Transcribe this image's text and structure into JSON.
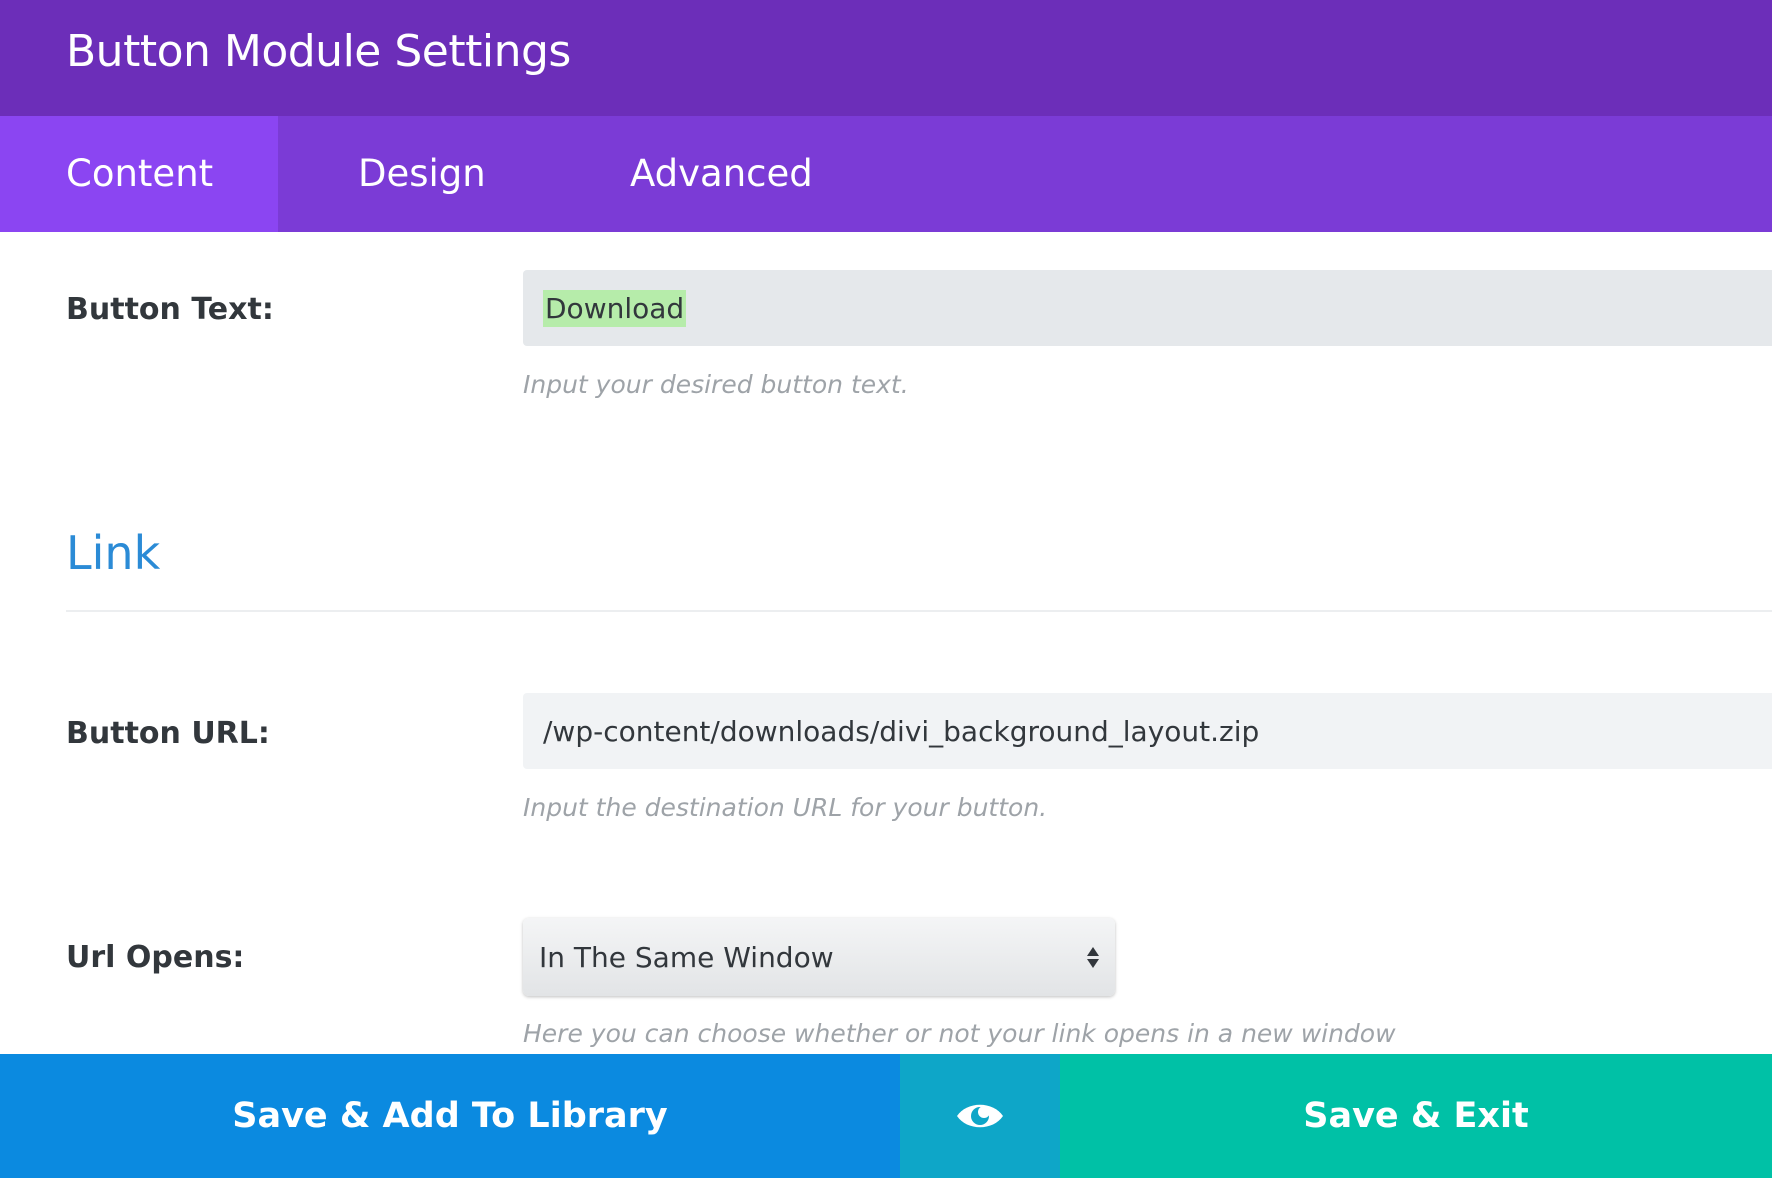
{
  "header": {
    "title": "Button Module Settings"
  },
  "tabs": [
    {
      "label": "Content",
      "active": true
    },
    {
      "label": "Design",
      "active": false
    },
    {
      "label": "Advanced",
      "active": false
    }
  ],
  "fields": {
    "button_text": {
      "label": "Button Text:",
      "value": "Download",
      "help": "Input your desired button text."
    },
    "link_section": {
      "title": "Link"
    },
    "button_url": {
      "label": "Button URL:",
      "value": "/wp-content/downloads/divi_background_layout.zip",
      "help": "Input the destination URL for your button."
    },
    "url_opens": {
      "label": "Url Opens:",
      "selected": "In The Same Window",
      "help": "Here you can choose whether or not your link opens in a new window"
    }
  },
  "footer": {
    "save_library_label": "Save & Add To Library",
    "preview_icon": "eye-icon",
    "save_exit_label": "Save & Exit"
  },
  "colors": {
    "header_bg": "#6c2eb9",
    "tabs_bg": "#7b3bd6",
    "active_tab_bg": "#8b45f2",
    "section_title": "#2b8bd6",
    "library_button": "#0b8ae0",
    "preview_button": "#0ea6c8",
    "exit_button": "#00c1a6"
  }
}
